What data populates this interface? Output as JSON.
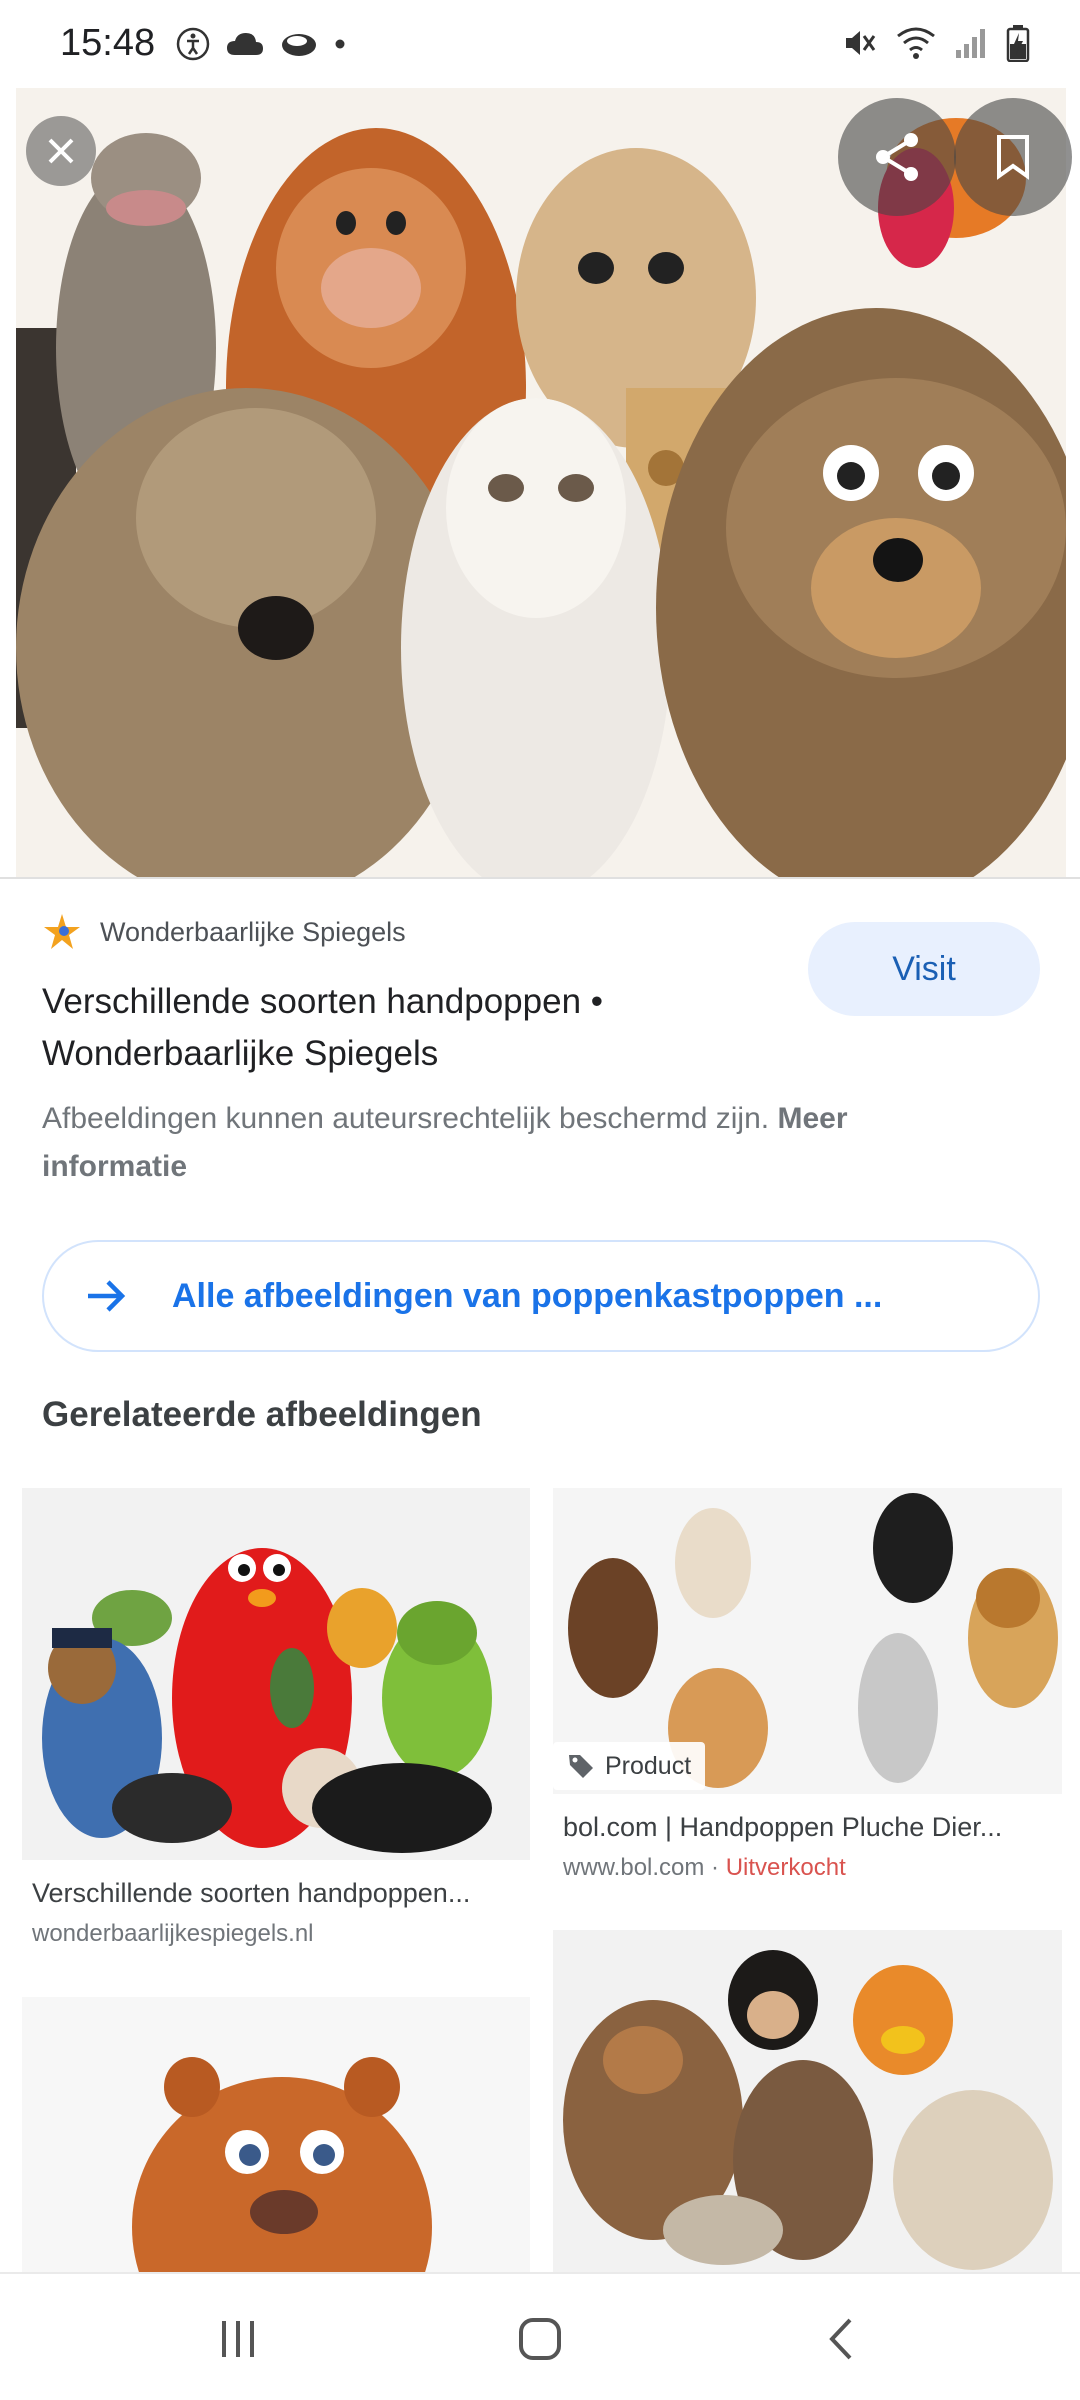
{
  "status_bar": {
    "time": "15:48",
    "left_icons": [
      "accessibility-icon",
      "cloud-icon",
      "cap-icon",
      "dot-icon"
    ],
    "right_icons": [
      "mute-icon",
      "wifi-icon",
      "signal-icon",
      "battery-icon"
    ]
  },
  "hero": {
    "close_icon": "close-icon",
    "share_icon": "share-icon",
    "bookmark_icon": "bookmark-icon",
    "image_description": "puppets-collage"
  },
  "source": {
    "site_name": "Wonderbaarlijke Spiegels",
    "visit_label": "Visit",
    "page_title": "Verschillende soorten handpoppen • Wonderbaarlijke Spiegels",
    "copyright_text": "Afbeeldingen kunnen auteursrechtelijk beschermd zijn.",
    "copyright_link": "Meer informatie"
  },
  "all_images": {
    "label": "Alle afbeeldingen van poppenkastpoppen ..."
  },
  "related": {
    "title": "Gerelateerde afbeeldingen",
    "items": [
      {
        "title": "Verschillende soorten handpoppen...",
        "domain": "wonderbaarlijkespiegels.nl"
      },
      {
        "badge": "Product",
        "title": "bol.com | Handpoppen Pluche Dier...",
        "domain": "www.bol.com",
        "separator": " · ",
        "status": "Uitverkocht"
      }
    ]
  },
  "colors": {
    "accent": "#1a73e8",
    "visit_bg": "#e8f0fe",
    "sold_out": "#d9534f"
  }
}
